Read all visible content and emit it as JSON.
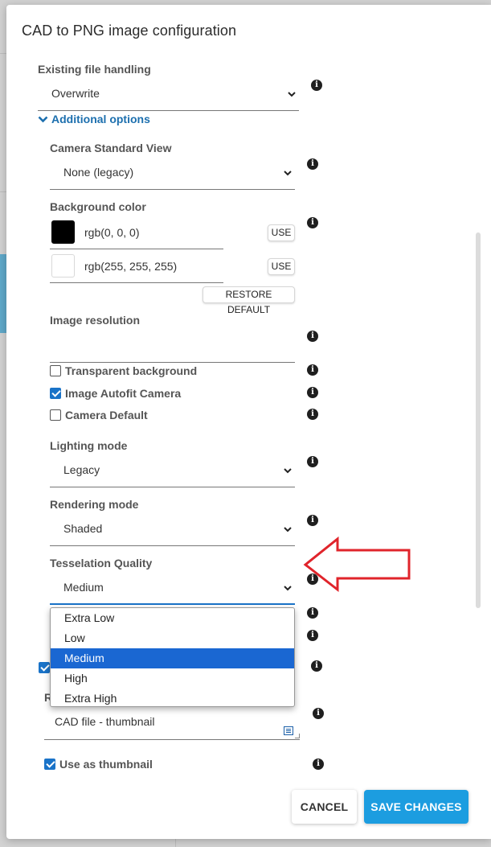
{
  "dialog": {
    "title": "CAD to PNG image configuration"
  },
  "existing_file": {
    "label": "Existing file handling",
    "value": "Overwrite"
  },
  "additional_options": {
    "label": "Additional options"
  },
  "camera_view": {
    "label": "Camera Standard View",
    "value": "None (legacy)"
  },
  "background_color": {
    "label": "Background color",
    "color1_text": "rgb(0, 0, 0)",
    "color1_hex": "#000000",
    "color2_text": "rgb(255, 255, 255)",
    "color2_hex": "#ffffff",
    "use_label": "USE",
    "restore_label": "RESTORE DEFAULT"
  },
  "image_resolution": {
    "label": "Image resolution",
    "value": ""
  },
  "checkboxes": {
    "transparent": {
      "label": "Transparent background",
      "checked": false
    },
    "autofit": {
      "label": "Image Autofit Camera",
      "checked": true
    },
    "camera_default": {
      "label": "Camera Default",
      "checked": false
    }
  },
  "lighting_mode": {
    "label": "Lighting mode",
    "value": "Legacy"
  },
  "rendering_mode": {
    "label": "Rendering mode",
    "value": "Shaded"
  },
  "tesselation": {
    "label": "Tesselation Quality",
    "value": "Medium",
    "options": [
      "Extra Low",
      "Low",
      "Medium",
      "High",
      "Extra High"
    ],
    "selected_index": 2
  },
  "resource_name": {
    "label_fragment": "R",
    "value": "CAD file - thumbnail"
  },
  "use_thumbnail": {
    "label": "Use as thumbnail",
    "checked": true
  },
  "footer": {
    "cancel_label": "CANCEL",
    "save_label": "SAVE CHANGES"
  },
  "colors": {
    "accent": "#1c9de0",
    "link": "#1c6fae",
    "selection": "#1a67d2",
    "annotation_arrow": "#e0242b"
  },
  "icons": {
    "info": "info-circle-icon",
    "chevron": "chevron-down-icon",
    "expand": "chevron-down-bold-icon",
    "textarea": "text-lines-icon"
  }
}
